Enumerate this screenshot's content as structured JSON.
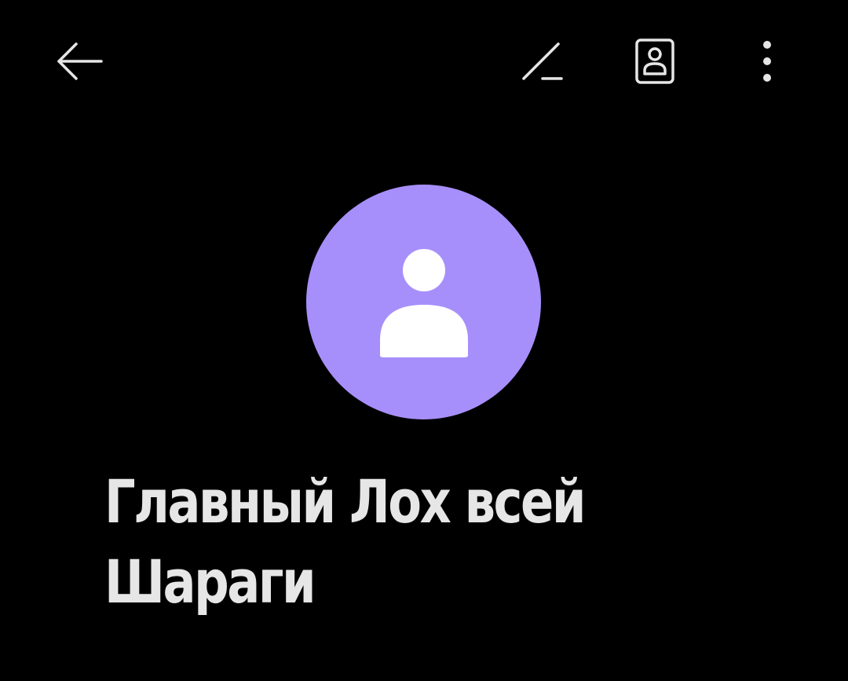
{
  "toolbar": {
    "back_icon": "arrow-left-icon",
    "edit_icon": "pencil-icon",
    "contact_card_icon": "contact-card-icon",
    "more_icon": "more-vertical-icon",
    "icon_color": "#e6e6e6"
  },
  "avatar": {
    "icon": "person-icon",
    "background_color": "#a78ffb",
    "icon_color": "#ffffff"
  },
  "contact": {
    "name": "Главный Лох всей Шараги",
    "text_color": "#e6e6e6"
  },
  "theme": {
    "background": "#000000"
  }
}
